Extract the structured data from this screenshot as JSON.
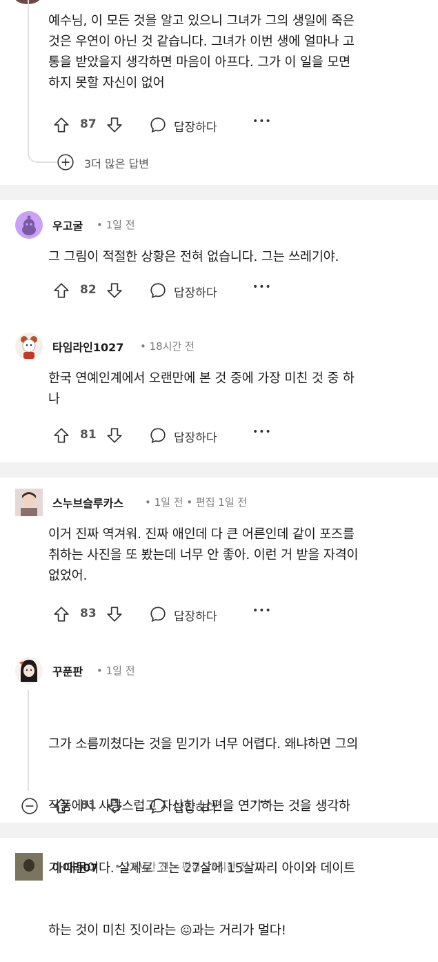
{
  "comments": [
    {
      "body": "예수님, 이 모든 것을 알고 있으니 그녀가 그의 생일에 죽은\n것은 우연이 아닌 것 같습니다. 그녀가 이번 생에 얼마나 고\n통을 받았을지 생각하면 마음이 아프다. 그가 이 일을 모면\n하지 못할 자신이 없어",
      "votes": "87",
      "reply_label": "답장하다",
      "more_label": "•••",
      "more_replies": "3더 많은 답변"
    },
    {
      "username": "우고굴",
      "meta": "• 1일 전",
      "body": "그 그림이 적절한 상황은 전혀 없습니다. 그는 쓰레기야.",
      "votes": "82",
      "reply_label": "답장하다",
      "more_label": "•••"
    },
    {
      "username": "타임라인1027",
      "meta": "• 18시간 전",
      "body": "한국 연예인계에서 오랜만에 본 것 중에 가장 미친 것 중 하\n나",
      "votes": "81",
      "reply_label": "답장하다",
      "more_label": "•••"
    },
    {
      "username": "스누브슬루카스",
      "meta": "• 1일 전 • 편집 1일 전",
      "body": "이거 진짜 역겨워. 진짜 애인데 다 큰 어른인데 같이 포즈를\n취하는 사진을 또 봤는데 너무 안 좋아. 이런 거 받을 자격이\n없었어.",
      "votes": "83",
      "reply_label": "답장하다",
      "more_label": "•••"
    },
    {
      "username": "꾸푼판",
      "meta": "• 1일 전",
      "body_line1": "그가 소름끼쳤다는 것을 믿기가 너무 어렵다. 왜냐하면 그의",
      "body_line2": "작품에서 사랑스럽고 자상한 남편을 연기하는 것을 생각하",
      "body_line3": "기 때문이다. 실제로 그는 27살에 15살짜리 아이와 데이트",
      "body_line4a": "하는 것이 미친 짓이라는 ",
      "emoji": "😖",
      "body_line4b": "과는 거리가 멀다!",
      "votes": "81",
      "reply_label": "답장하다",
      "more_label": "•••"
    },
    {
      "username": "아이라07",
      "meta": "• 23시간 전 • 편집 23시간 전"
    }
  ],
  "colors": {
    "separator": "#f2f2f2",
    "thread_line": "#e0e0e0",
    "meta_text": "#7c7c7c",
    "avatar_snoo": "#c9a2f5"
  }
}
